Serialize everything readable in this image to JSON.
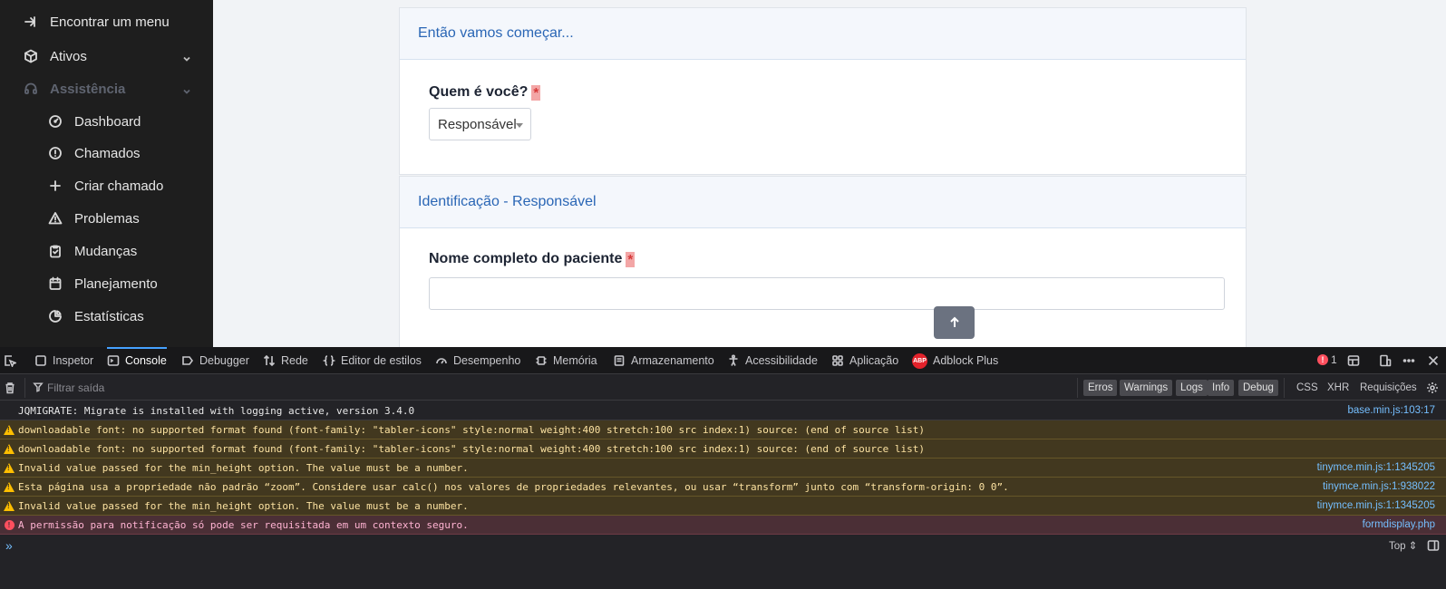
{
  "sidebar": {
    "items": [
      {
        "label": "Encontrar um menu",
        "icon": "arrow-right-circle-icon"
      },
      {
        "label": "Ativos",
        "icon": "cube-icon"
      },
      {
        "label": "Assistência",
        "icon": "headset-icon"
      },
      {
        "label": "Dashboard",
        "icon": "gauge-icon"
      },
      {
        "label": "Chamados",
        "icon": "alert-circle-icon"
      },
      {
        "label": "Criar chamado",
        "icon": "plus-icon"
      },
      {
        "label": "Problemas",
        "icon": "warning-triangle-icon"
      },
      {
        "label": "Mudanças",
        "icon": "clipboard-icon"
      },
      {
        "label": "Planejamento",
        "icon": "calendar-icon"
      },
      {
        "label": "Estatísticas",
        "icon": "pie-chart-icon"
      }
    ]
  },
  "form": {
    "section1_title": "Então vamos começar...",
    "who_label": "Quem é você?",
    "who_value": "Responsável",
    "section2_title": "Identificação - Responsável",
    "patient_name_label": "Nome completo do paciente",
    "patient_name_value": "",
    "required_mark": "*"
  },
  "devtools": {
    "tabs": [
      "Inspetor",
      "Console",
      "Debugger",
      "Rede",
      "Editor de estilos",
      "Desempenho",
      "Memória",
      "Armazenamento",
      "Acessibilidade",
      "Aplicação",
      "Adblock Plus"
    ],
    "active_tab": "Console",
    "abp_badge": "ABP",
    "error_count": "1",
    "filter_placeholder": "Filtrar saída",
    "filter_buttons": [
      "Erros",
      "Warnings",
      "Logs",
      "Info",
      "Debug"
    ],
    "filter_links": [
      "CSS",
      "XHR",
      "Requisições"
    ],
    "messages": [
      {
        "level": "log",
        "text": "JQMIGRATE: Migrate is installed with logging active, version 3.4.0",
        "source": "base.min.js:103:17"
      },
      {
        "level": "warn",
        "text": "downloadable font: no supported format found (font-family: \"tabler-icons\" style:normal weight:400 stretch:100 src index:1) source: (end of source list)",
        "source": ""
      },
      {
        "level": "warn",
        "text": "downloadable font: no supported format found (font-family: \"tabler-icons\" style:normal weight:400 stretch:100 src index:1) source: (end of source list)",
        "source": ""
      },
      {
        "level": "warn",
        "text": "Invalid value passed for the min_height option. The value must be a number.",
        "source": "tinymce.min.js:1:1345205"
      },
      {
        "level": "warn",
        "text": "Esta página usa a propriedade não padrão “zoom”. Considere usar calc() nos valores de propriedades relevantes, ou usar “transform” junto com “transform-origin: 0 0”.",
        "source": "tinymce.min.js:1:938022"
      },
      {
        "level": "warn",
        "text": "Invalid value passed for the min_height option. The value must be a number.",
        "source": "tinymce.min.js:1:1345205"
      },
      {
        "level": "error",
        "text": "A permissão para notificação só pode ser requisitada em um contexto seguro.",
        "source": "formdisplay.php"
      }
    ],
    "context_selector": "Top ⇕"
  }
}
